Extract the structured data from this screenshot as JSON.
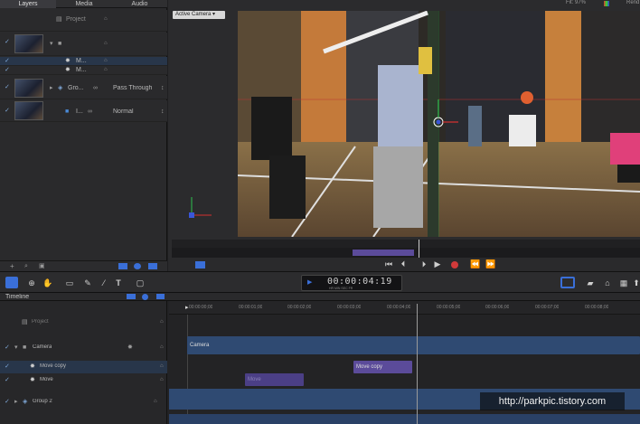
{
  "tabs": [
    "Layers",
    "Media",
    "Audio"
  ],
  "top_right": {
    "fit_label": "Fit: 97%",
    "render_label": "Rend"
  },
  "layers": {
    "project": "Project",
    "group1_name": "",
    "move_copy_short": "M...",
    "move_short": "M...",
    "group2_name": "Gro...",
    "group2_blend": "Pass Through",
    "layer_name": "I...",
    "layer_blend": "Normal"
  },
  "canvas": {
    "camera_menu": "Active Camera"
  },
  "transport": {
    "timecode": "00:00:04:19",
    "timecode_units": "HR   MIN   SEC   FR"
  },
  "timeline": {
    "label": "Timeline",
    "rows": {
      "project": "Project",
      "camera": "Camera",
      "move_copy": "Move copy",
      "move": "Move",
      "group2": "Group 2"
    },
    "ruler_ticks": [
      "00:00:00;00",
      "00:00:01;00",
      "00:00:02;00",
      "00:00:03;00",
      "00:00:04;00",
      "00:00:05;00",
      "00:00:06;00",
      "00:00:07;00",
      "00:00:08;00"
    ],
    "clips": {
      "camera": "Camera",
      "move_copy": "Move copy",
      "move": "Move"
    }
  },
  "watermark": "http://parkpic.tistory.com",
  "colors": {
    "accent_blue": "#3a6fd8",
    "clip_purple": "#5b4b9a",
    "track_blue": "#2f4a72"
  }
}
